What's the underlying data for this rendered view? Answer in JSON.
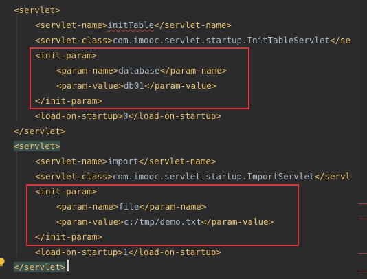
{
  "editor": {
    "lines": [
      {
        "indent": 0,
        "parts": [
          {
            "t": "tag",
            "v": "<servlet>"
          }
        ]
      },
      {
        "indent": 1,
        "parts": [
          {
            "t": "tag",
            "v": "<servlet-name>"
          },
          {
            "t": "txt",
            "v": "initTable",
            "sq": true
          },
          {
            "t": "tag",
            "v": "</servlet-name>"
          }
        ]
      },
      {
        "indent": 1,
        "parts": [
          {
            "t": "tag",
            "v": "<servlet-class>"
          },
          {
            "t": "txt",
            "v": "com.imooc.servlet.startup.InitTableServlet"
          },
          {
            "t": "tag",
            "v": "</se"
          }
        ]
      },
      {
        "indent": 1,
        "parts": [
          {
            "t": "tag",
            "v": "<init-param>"
          }
        ]
      },
      {
        "indent": 2,
        "parts": [
          {
            "t": "tag",
            "v": "<param-name>"
          },
          {
            "t": "txt",
            "v": "database"
          },
          {
            "t": "tag",
            "v": "</param-name>"
          }
        ]
      },
      {
        "indent": 2,
        "parts": [
          {
            "t": "tag",
            "v": "<param-value>"
          },
          {
            "t": "txt",
            "v": "db01"
          },
          {
            "t": "tag",
            "v": "</param-value>"
          }
        ]
      },
      {
        "indent": 1,
        "parts": [
          {
            "t": "tag",
            "v": "</init-param>"
          }
        ]
      },
      {
        "indent": 1,
        "parts": [
          {
            "t": "tag",
            "v": "<load-on-startup>"
          },
          {
            "t": "txt",
            "v": "0"
          },
          {
            "t": "tag",
            "v": "</load-on-startup>"
          }
        ]
      },
      {
        "indent": 0,
        "parts": [
          {
            "t": "tag",
            "v": "</servlet>"
          }
        ]
      },
      {
        "indent": 0,
        "parts": [
          {
            "t": "tag",
            "v": "<servlet>",
            "hl": true
          }
        ]
      },
      {
        "indent": 1,
        "parts": [
          {
            "t": "tag",
            "v": "<servlet-name>"
          },
          {
            "t": "txt",
            "v": "import"
          },
          {
            "t": "tag",
            "v": "</servlet-name>"
          }
        ]
      },
      {
        "indent": 1,
        "parts": [
          {
            "t": "tag",
            "v": "<servlet-class>"
          },
          {
            "t": "txt",
            "v": "com.imooc.servlet.startup.ImportServlet"
          },
          {
            "t": "tag",
            "v": "</servl"
          }
        ]
      },
      {
        "indent": 1,
        "parts": [
          {
            "t": "tag",
            "v": "<init-param>"
          }
        ]
      },
      {
        "indent": 2,
        "parts": [
          {
            "t": "tag",
            "v": "<param-name>"
          },
          {
            "t": "txt",
            "v": "file"
          },
          {
            "t": "tag",
            "v": "</param-name>"
          }
        ]
      },
      {
        "indent": 2,
        "parts": [
          {
            "t": "tag",
            "v": "<param-value>"
          },
          {
            "t": "txt",
            "v": "c:/tmp/demo.txt"
          },
          {
            "t": "tag",
            "v": "</param-value>"
          }
        ]
      },
      {
        "indent": 1,
        "parts": [
          {
            "t": "tag",
            "v": "</init-param>"
          }
        ]
      },
      {
        "indent": 1,
        "parts": [
          {
            "t": "tag",
            "v": "<load-on-startup>"
          },
          {
            "t": "txt",
            "v": "1"
          },
          {
            "t": "tag",
            "v": "</load-on-startup>"
          }
        ]
      },
      {
        "indent": 0,
        "parts": [
          {
            "t": "tag",
            "v": "</servlet>",
            "hl": true
          }
        ]
      }
    ]
  },
  "colors": {
    "background": "#2b2b2b",
    "tag": "#e8bf6a",
    "text": "#a9b7c6",
    "annotation_box": "#e0343d",
    "tag_match_highlight": "#3b514d"
  },
  "icons": {
    "gutter_hint": "lightbulb-icon"
  }
}
